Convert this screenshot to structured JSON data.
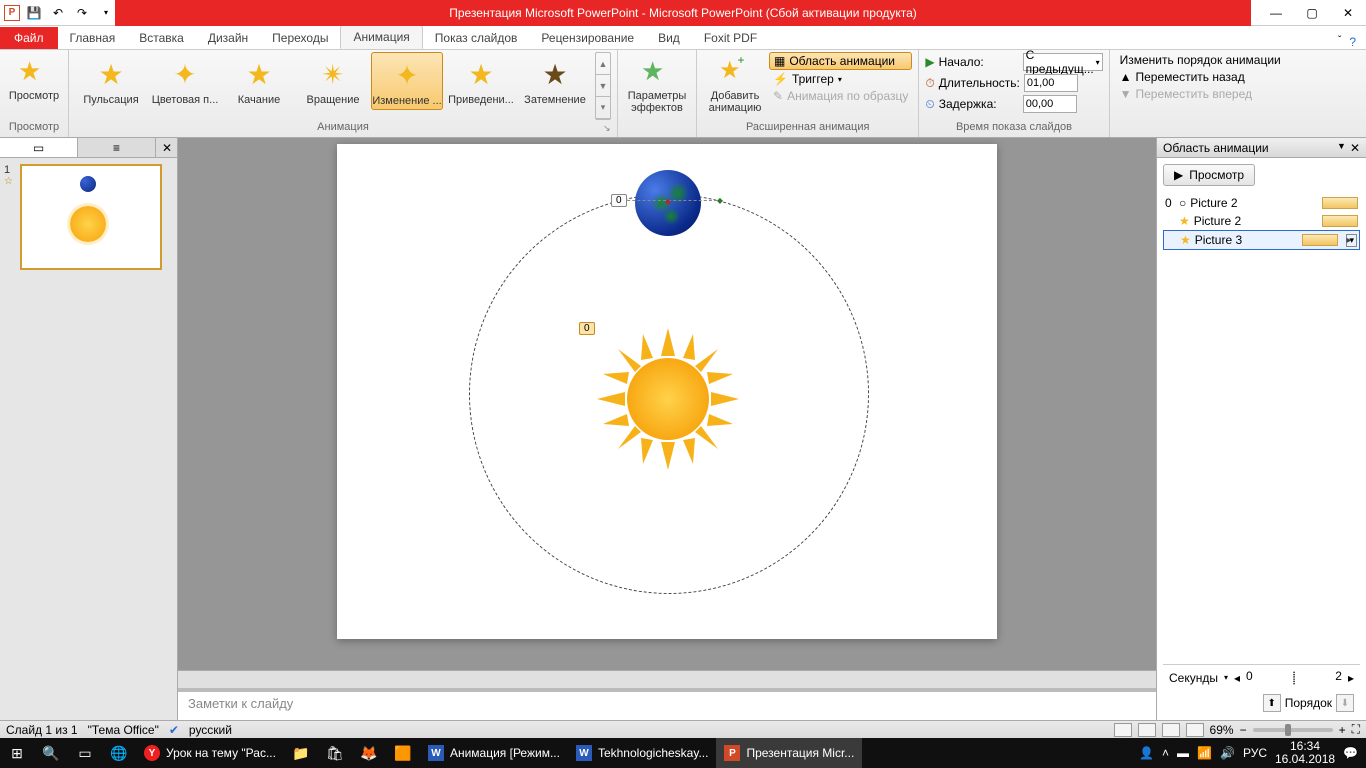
{
  "title": "Презентация Microsoft PowerPoint - Microsoft PowerPoint (Сбой активации продукта)",
  "app_letter": "P",
  "ribbon": {
    "file": "Файл",
    "tabs": [
      "Главная",
      "Вставка",
      "Дизайн",
      "Переходы",
      "Анимация",
      "Показ слайдов",
      "Рецензирование",
      "Вид",
      "Foxit PDF"
    ],
    "active_tab": "Анимация",
    "preview_group": {
      "btn": "Просмотр",
      "label": "Просмотр"
    },
    "animation_group": {
      "items": [
        "Пульсация",
        "Цветовая п...",
        "Качание",
        "Вращение",
        "Изменение ...",
        "Приведени...",
        "Затемнение"
      ],
      "selected": "Изменение ...",
      "label": "Анимация"
    },
    "effect_opts": "Параметры\nэффектов",
    "advanced": {
      "add": "Добавить\nанимацию",
      "pane_btn": "Область анимации",
      "trigger": "Триггер",
      "painter": "Анимация по образцу",
      "label": "Расширенная анимация"
    },
    "timing": {
      "start_label": "Начало:",
      "start_value": "С предыдущ...",
      "dur_label": "Длительность:",
      "dur_value": "01,00",
      "delay_label": "Задержка:",
      "delay_value": "00,00",
      "label": "Время показа слайдов"
    },
    "reorder": {
      "title": "Изменить порядок анимации",
      "back": "Переместить назад",
      "forward": "Переместить вперед"
    }
  },
  "thumb": {
    "num": "1",
    "star": "☆"
  },
  "slide": {
    "tag_a": "0",
    "tag_b": "0"
  },
  "notes_placeholder": "Заметки к слайду",
  "anim_pane": {
    "title": "Область анимации",
    "play": "Просмотр",
    "entries": [
      {
        "seq": "0",
        "icon": "○",
        "name": "Picture 2"
      },
      {
        "seq": "",
        "icon": "★",
        "name": "Picture 2"
      },
      {
        "seq": "",
        "icon": "★",
        "name": "Picture 3",
        "selected": true
      }
    ],
    "seconds": "Секунды",
    "tick0": "0",
    "tick2": "2",
    "order": "Порядок"
  },
  "status": {
    "slide": "Слайд 1 из 1",
    "theme": "\"Тема Office\"",
    "lang": "русский",
    "zoom": "69%"
  },
  "taskbar": {
    "items": [
      {
        "icon": "Y",
        "label": "Урок на тему \"Рас..."
      },
      {
        "icon": "📁",
        "label": ""
      },
      {
        "icon": "🛍",
        "label": ""
      },
      {
        "icon": "🦊",
        "label": ""
      },
      {
        "icon": "🟧",
        "label": ""
      },
      {
        "icon": "W",
        "label": "Анимация [Режим..."
      },
      {
        "icon": "W",
        "label": "Tekhnologicheskay..."
      },
      {
        "icon": "P",
        "label": "Презентация Micr...",
        "active": true
      }
    ],
    "lang": "РУС",
    "time": "16:34",
    "date": "16.04.2018"
  }
}
